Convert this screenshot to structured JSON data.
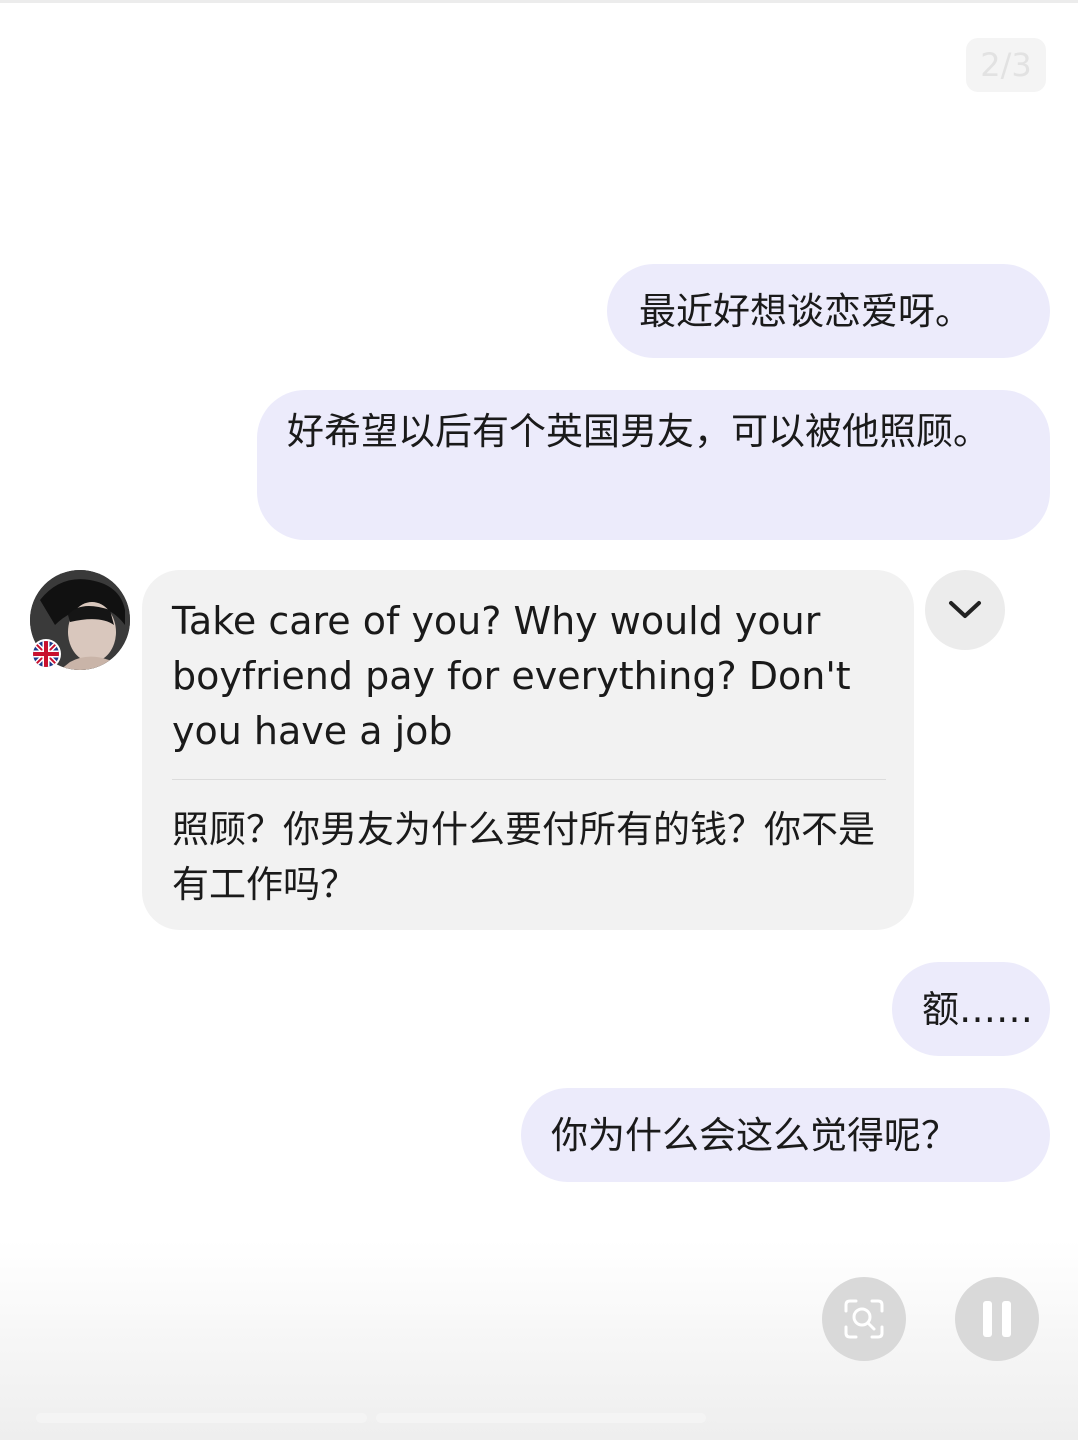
{
  "page_indicator": "2/3",
  "messages": [
    {
      "text": "最近好想谈恋爱呀。"
    },
    {
      "text": "好希望以后有个英国男友，可以被他照顾。"
    },
    {
      "original": "Take care of you? Why would your boyfriend pay for everything? Don't you have a job",
      "translation": "照顾？你男友为什么要付所有的钱？你不是有工作吗？"
    },
    {
      "text": "额……"
    },
    {
      "text": "你为什么会这么觉得呢？"
    }
  ],
  "icons": {
    "expand": "chevron-down-icon",
    "scan": "scan-search-icon",
    "pause": "pause-icon",
    "flag": "uk-flag-icon"
  }
}
